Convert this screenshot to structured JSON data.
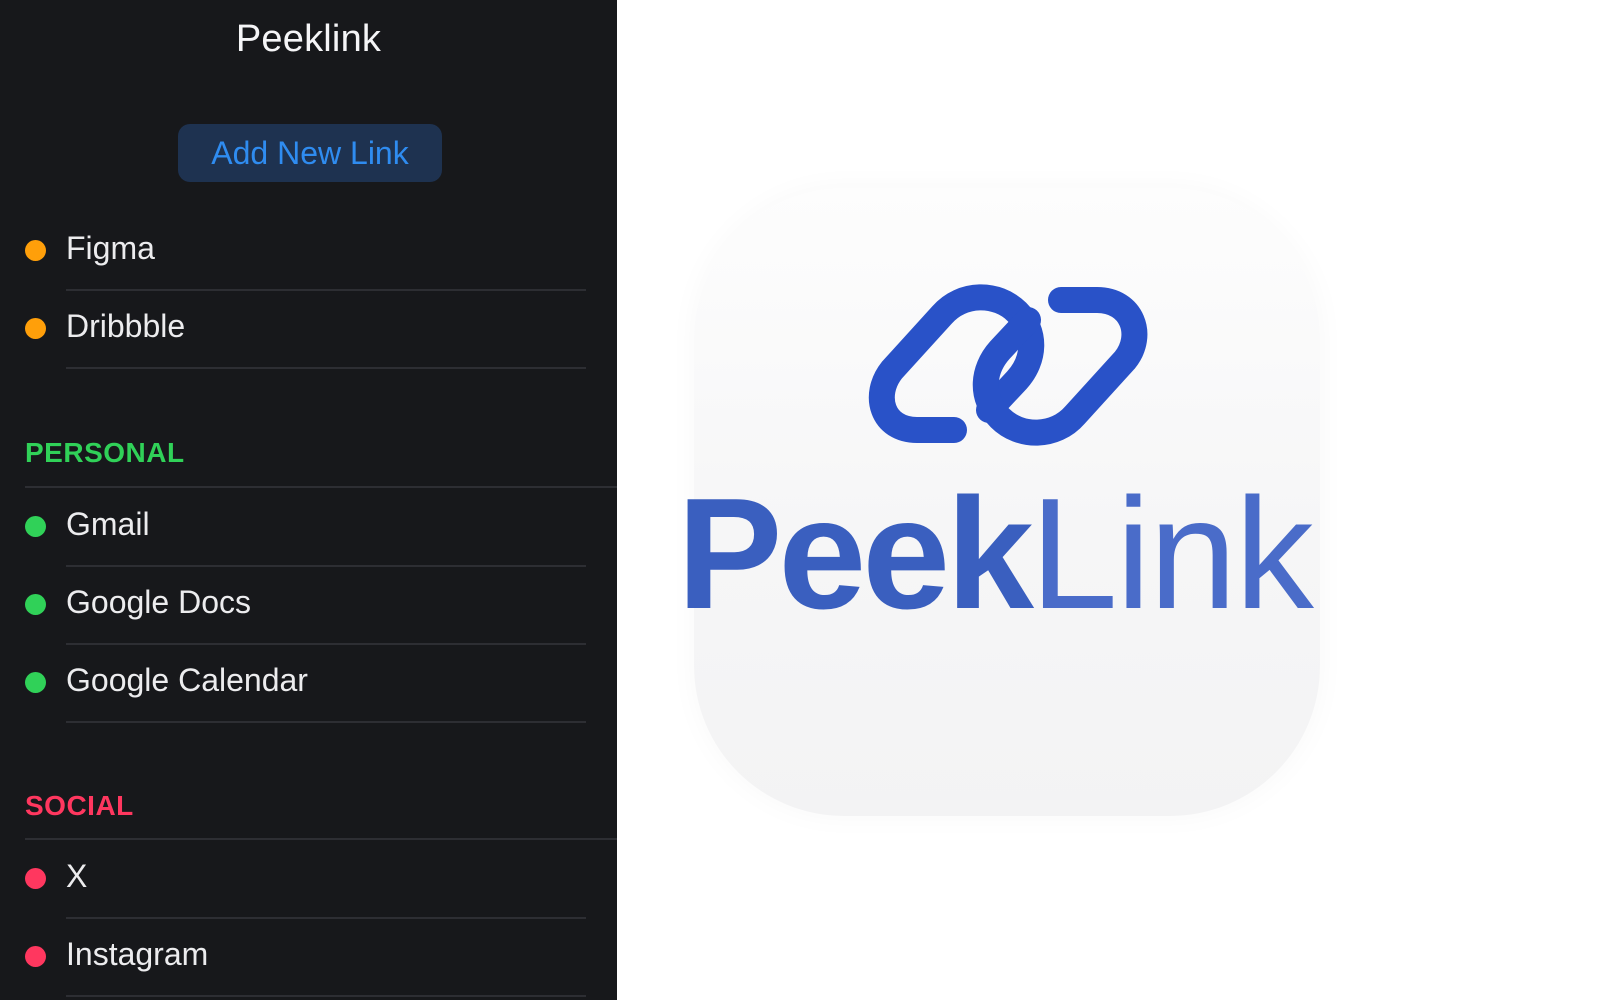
{
  "app": {
    "title": "Peeklink"
  },
  "toolbar": {
    "add_label": "Add New Link"
  },
  "colors": {
    "sidebar_bg": "#17181b",
    "accent_blue": "#2f8cf0",
    "work_dot": "#ff9f0a",
    "personal": "#30d158",
    "social": "#ff375f",
    "logo_blue": "#2952c8"
  },
  "links_top": [
    {
      "label": "Figma"
    },
    {
      "label": "Dribbble"
    }
  ],
  "sections": {
    "personal": {
      "title": "PERSONAL",
      "items": [
        {
          "label": "Gmail"
        },
        {
          "label": "Google Docs"
        },
        {
          "label": "Google Calendar"
        }
      ]
    },
    "social": {
      "title": "SOCIAL",
      "items": [
        {
          "label": "X"
        },
        {
          "label": "Instagram"
        }
      ]
    }
  },
  "logo": {
    "icon": "chain-link-icon",
    "word_bold": "Peek",
    "word_light": "Link"
  }
}
